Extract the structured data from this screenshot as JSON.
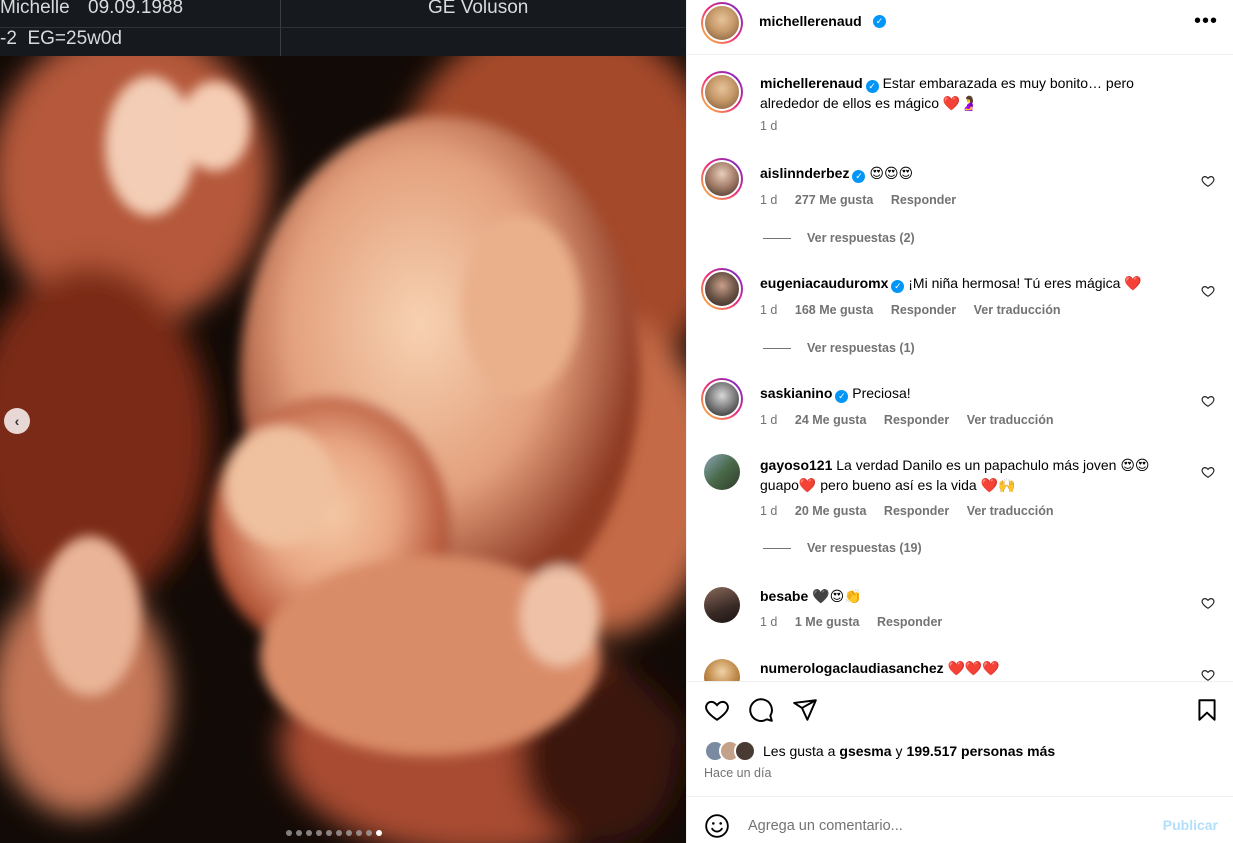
{
  "ultrasound": {
    "patient": "Michelle",
    "date": "09.09.1988",
    "device": "GE Voluson",
    "ga": "-2  EG=25w0d"
  },
  "carousel": {
    "prev_icon": "chevron-left-icon",
    "total_slides": 10,
    "active_slide": 10
  },
  "post": {
    "author": "michellerenaud",
    "verified": true,
    "caption": "Estar embarazada es muy bonito… pero alrededor de ellos es mágico ❤️🤰",
    "caption_time": "1 d"
  },
  "comments": [
    {
      "user": "aislinnderbez",
      "verified": true,
      "text": "😍😍😍",
      "time": "1 d",
      "likes": "277 Me gusta",
      "reply": "Responder",
      "translate": "",
      "view_replies": "Ver respuestas (2)"
    },
    {
      "user": "eugeniacauduromx",
      "verified": true,
      "text": "¡Mi niña hermosa! Tú eres mágica ❤️",
      "time": "1 d",
      "likes": "168 Me gusta",
      "reply": "Responder",
      "translate": "Ver traducción",
      "view_replies": "Ver respuestas (1)"
    },
    {
      "user": "saskianino",
      "verified": true,
      "text": "Preciosa!",
      "time": "1 d",
      "likes": "24 Me gusta",
      "reply": "Responder",
      "translate": "Ver traducción",
      "view_replies": ""
    },
    {
      "user": "gayoso121",
      "verified": false,
      "text": "La verdad Danilo es un papachulo más joven 😍😍 guapo❤️ pero bueno así es la vida ❤️🙌",
      "time": "1 d",
      "likes": "20 Me gusta",
      "reply": "Responder",
      "translate": "Ver traducción",
      "view_replies": "Ver respuestas (19)"
    },
    {
      "user": "besabe",
      "verified": false,
      "text": "🖤😍👏",
      "time": "1 d",
      "likes": "1 Me gusta",
      "reply": "Responder",
      "translate": "",
      "view_replies": ""
    },
    {
      "user": "numerologaclaudiasanchez",
      "verified": false,
      "text": "❤️❤️❤️",
      "time": "",
      "likes": "",
      "reply": "",
      "translate": "",
      "view_replies": ""
    }
  ],
  "actions": {
    "like_icon": "heart-icon",
    "comment_icon": "comment-icon",
    "share_icon": "send-icon",
    "save_icon": "bookmark-icon",
    "likes_prefix": "Les gusta a",
    "likes_user": "gsesma",
    "likes_and": "y",
    "likes_rest": "199.517 personas más",
    "time_ago": "Hace un día"
  },
  "add_comment": {
    "emoji_icon": "smiley-icon",
    "placeholder": "Agrega un comentario...",
    "publish": "Publicar"
  },
  "colors": {
    "verified": "#0095f6",
    "publish_disabled": "#b2dffc",
    "secondary_text": "#737373"
  }
}
